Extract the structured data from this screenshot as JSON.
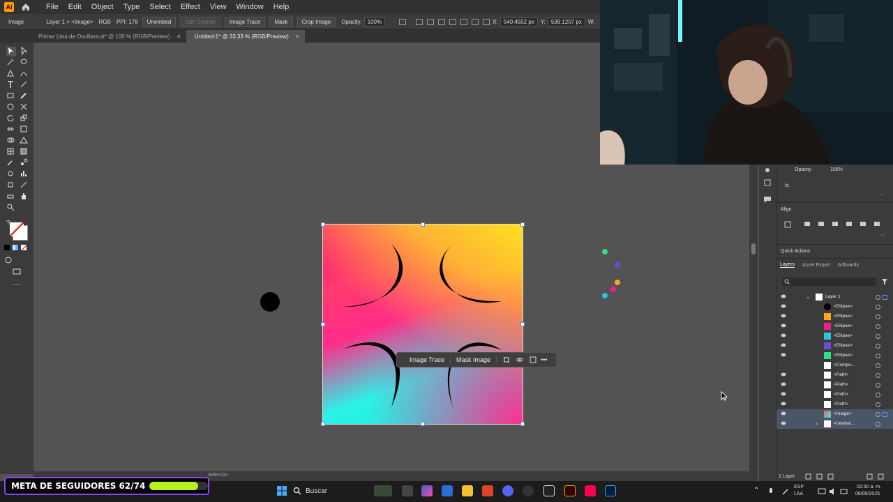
{
  "app": {
    "logo_text": "Ai"
  },
  "menu": [
    "File",
    "Edit",
    "Object",
    "Type",
    "Select",
    "Effect",
    "View",
    "Window",
    "Help"
  ],
  "control_bar": {
    "selection_type": "Image",
    "layer_path": "Layer 1 > <Image>",
    "color_mode": "RGB",
    "ppi": "PPI: 178",
    "unembed": "Unembed",
    "edit_original": "Edit Original",
    "image_trace": "Image Trace",
    "mask": "Mask",
    "crop_image": "Crop Image",
    "opacity_label": "Opacity:",
    "opacity_value": "100%",
    "x_label": "X:",
    "x_value": "540.4552 px",
    "y_label": "Y:",
    "y_value": "539.1207 px",
    "w_label": "W:"
  },
  "tabs": [
    {
      "label": "Primer (dea de Oscillara.ai* @ 100 % (RGB/Preview)",
      "close": "×"
    },
    {
      "label": "Untitled-1* @ 33.33 % (RGB/Preview)",
      "close": "×"
    }
  ],
  "context_bar": {
    "image_trace": "Image Trace",
    "mask_image": "Mask Image",
    "more": "•••"
  },
  "status": {
    "tool": "Selection"
  },
  "right_panel": {
    "opacity_label": "Opacity",
    "opacity_value": "100%",
    "fx": "fx.",
    "align_title": "Align",
    "quick_actions": "Quick Actions",
    "layer_tabs": [
      "Layers",
      "Asset Export",
      "Artboards"
    ],
    "layers": [
      {
        "name": "Layer 1",
        "thumb": "#ffffff"
      },
      {
        "name": "<Ellipse>",
        "thumb": "#000000"
      },
      {
        "name": "<Ellipse>",
        "thumb": "#ffa81e"
      },
      {
        "name": "<Ellipse>",
        "thumb": "#ff1a8c"
      },
      {
        "name": "<Ellipse>",
        "thumb": "#26c8e0"
      },
      {
        "name": "<Ellipse>",
        "thumb": "#6b4cd6"
      },
      {
        "name": "<Ellipse>",
        "thumb": "#2ee08a"
      },
      {
        "name": "<Compo...",
        "thumb": "#ffffff"
      },
      {
        "name": "<Path>",
        "thumb": "#ffffff"
      },
      {
        "name": "<Path>",
        "thumb": "#ffffff"
      },
      {
        "name": "<Path>",
        "thumb": "#ffffff"
      },
      {
        "name": "<Path>",
        "thumb": "#ffffff"
      },
      {
        "name": "<Image>",
        "thumb": "#ff5a5a"
      },
      {
        "name": "<Interlwi...",
        "thumb": "#ffffff"
      }
    ],
    "footer": "1 Layer"
  },
  "goal": {
    "label": "META DE SEGUIDORES 62/74",
    "current": 62,
    "target": 74
  },
  "taskbar": {
    "search": "Buscar",
    "lang": "ESP",
    "lang2": "LAA",
    "time": "02:30 a. m.",
    "date": "06/09/2025"
  },
  "colors": {
    "accent": "#8844ff",
    "goal_fill": "#b6f21e"
  }
}
